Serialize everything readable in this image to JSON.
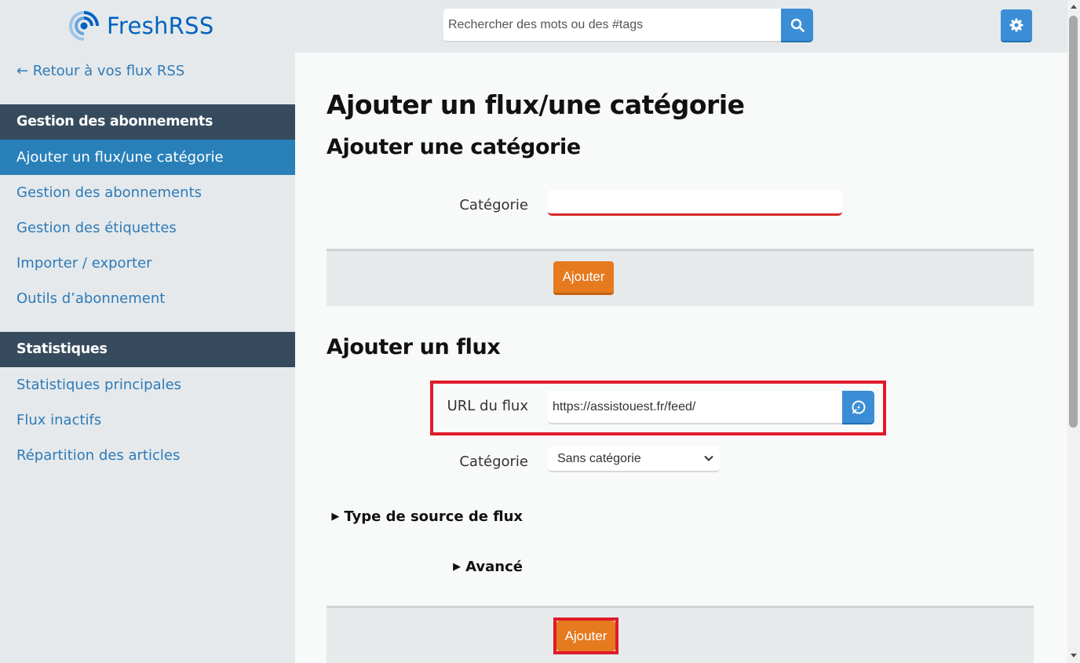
{
  "header": {
    "logo_text": "FreshRSS",
    "search_placeholder": "Rechercher des mots ou des #tags",
    "search_value": ""
  },
  "sidebar": {
    "back_link": "← Retour à vos flux RSS",
    "sections": [
      {
        "title": "Gestion des abonnements",
        "items": [
          {
            "label": "Ajouter un flux/une catégorie",
            "active": true
          },
          {
            "label": "Gestion des abonnements",
            "active": false
          },
          {
            "label": "Gestion des étiquettes",
            "active": false
          },
          {
            "label": "Importer / exporter",
            "active": false
          },
          {
            "label": "Outils d’abonnement",
            "active": false
          }
        ]
      },
      {
        "title": "Statistiques",
        "items": [
          {
            "label": "Statistiques principales",
            "active": false
          },
          {
            "label": "Flux inactifs",
            "active": false
          },
          {
            "label": "Répartition des articles",
            "active": false
          }
        ]
      }
    ]
  },
  "main": {
    "title": "Ajouter un flux/une catégorie",
    "add_category": {
      "heading": "Ajouter une catégorie",
      "label": "Catégorie",
      "value": "",
      "submit": "Ajouter"
    },
    "add_feed": {
      "heading": "Ajouter un flux",
      "url_label": "URL du flux",
      "url_value": "https://assistouest.fr/feed/",
      "category_label": "Catégorie",
      "category_selected": "Sans catégorie",
      "details_source": "Type de source de flux",
      "details_advanced": "Avancé",
      "submit": "Ajouter"
    }
  },
  "colors": {
    "brand": "#0062be",
    "accent": "#3b8ed6",
    "active_nav": "#2980b9",
    "section_header": "#374b5e",
    "submit": "#e57a1f",
    "highlight": "#e01b2a"
  }
}
